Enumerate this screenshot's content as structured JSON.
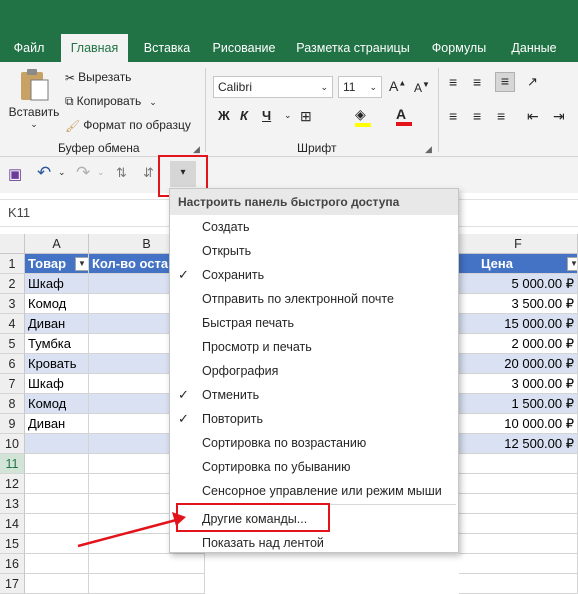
{
  "tabs": [
    "Файл",
    "Главная",
    "Вставка",
    "Рисование",
    "Разметка страницы",
    "Формулы",
    "Данные"
  ],
  "clipboard": {
    "paste": "Вставить",
    "cut": "Вырезать",
    "copy": "Копировать",
    "format_painter": "Формат по образцу",
    "group": "Буфер обмена"
  },
  "font": {
    "name": "Calibri",
    "size": "11",
    "bold": "Ж",
    "italic": "К",
    "underline": "Ч",
    "group": "Шрифт"
  },
  "name_box": "K11",
  "columns": [
    "A",
    "B",
    "F"
  ],
  "rows": [
    "1",
    "2",
    "3",
    "4",
    "5",
    "6",
    "7",
    "8",
    "9",
    "10",
    "11",
    "12",
    "13",
    "14",
    "15",
    "16",
    "17"
  ],
  "table": {
    "header_a": "Товар",
    "header_b": "Кол-во оста",
    "header_f": "Цена",
    "items": [
      "Шкаф",
      "Комод",
      "Диван",
      "Тумбка",
      "Кровать",
      "Шкаф",
      "Комод",
      "Диван"
    ],
    "prices": [
      "5 000.00 ₽",
      "3 500.00 ₽",
      "15 000.00 ₽",
      "2 000.00 ₽",
      "20 000.00 ₽",
      "3 000.00 ₽",
      "1 500.00 ₽",
      "10 000.00 ₽",
      "12 500.00 ₽"
    ]
  },
  "menu": {
    "title": "Настроить панель быстрого доступа",
    "items": [
      {
        "label": "Создать",
        "checked": false
      },
      {
        "label": "Открыть",
        "checked": false
      },
      {
        "label": "Сохранить",
        "checked": true
      },
      {
        "label": "Отправить по электронной почте",
        "checked": false
      },
      {
        "label": "Быстрая печать",
        "checked": false
      },
      {
        "label": "Просмотр и печать",
        "checked": false
      },
      {
        "label": "Орфография",
        "checked": false
      },
      {
        "label": "Отменить",
        "checked": true
      },
      {
        "label": "Повторить",
        "checked": true
      },
      {
        "label": "Сортировка по возрастанию",
        "checked": false
      },
      {
        "label": "Сортировка по убыванию",
        "checked": false
      },
      {
        "label": "Сенсорное управление или режим мыши",
        "checked": false
      },
      {
        "label": "Другие команды...",
        "checked": false
      },
      {
        "label": "Показать над лентой",
        "checked": false
      }
    ]
  },
  "checkmark": "✓",
  "colors": {
    "excel_green": "#217346",
    "table_header": "#4472c4",
    "band": "#d9e1f2",
    "highlight": "#e3131b"
  }
}
